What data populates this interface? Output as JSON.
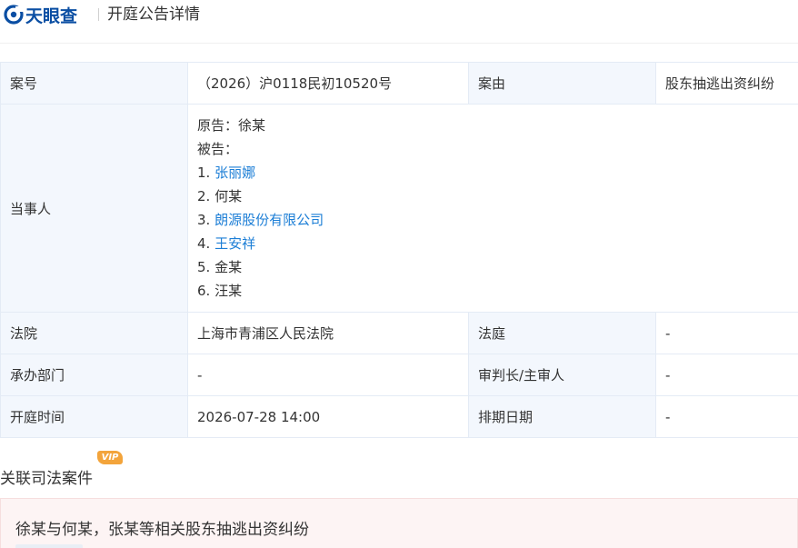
{
  "header": {
    "logo_text": "天眼查",
    "page_title": "开庭公告详情"
  },
  "case": {
    "case_no_label": "案号",
    "case_no": "（2026）沪0118民初10520号",
    "cause_label": "案由",
    "cause": "股东抽逃出资纠纷",
    "parties_label": "当事人",
    "plaintiff": "原告：徐某",
    "defendant_heading": "被告：",
    "defendants": [
      {
        "index": "1.",
        "name": "张丽娜",
        "linked": true
      },
      {
        "index": "2.",
        "name": "何某",
        "linked": false
      },
      {
        "index": "3.",
        "name": "朗源股份有限公司",
        "linked": true
      },
      {
        "index": "4.",
        "name": "王安祥",
        "linked": true
      },
      {
        "index": "5.",
        "name": "金某",
        "linked": false
      },
      {
        "index": "6.",
        "name": "汪某",
        "linked": false
      }
    ],
    "court_label": "法院",
    "court": "上海市青浦区人民法院",
    "tribunal_label": "法庭",
    "tribunal": "-",
    "department_label": "承办部门",
    "department": "-",
    "judge_label": "审判长/主审人",
    "judge": "-",
    "hearing_time_label": "开庭时间",
    "hearing_time": "2026-07-28 14:00",
    "schedule_date_label": "排期日期",
    "schedule_date": "-"
  },
  "related": {
    "section_title": "关联司法案件",
    "vip_badge": "VIP",
    "card_title": "徐某与何某，张某等相关股东抽逃出资纠纷"
  },
  "colors": {
    "brand": "#0a4ea3",
    "link": "#1c7ed6",
    "label_bg": "#f3f7fd",
    "vip": "#f3a43b"
  }
}
